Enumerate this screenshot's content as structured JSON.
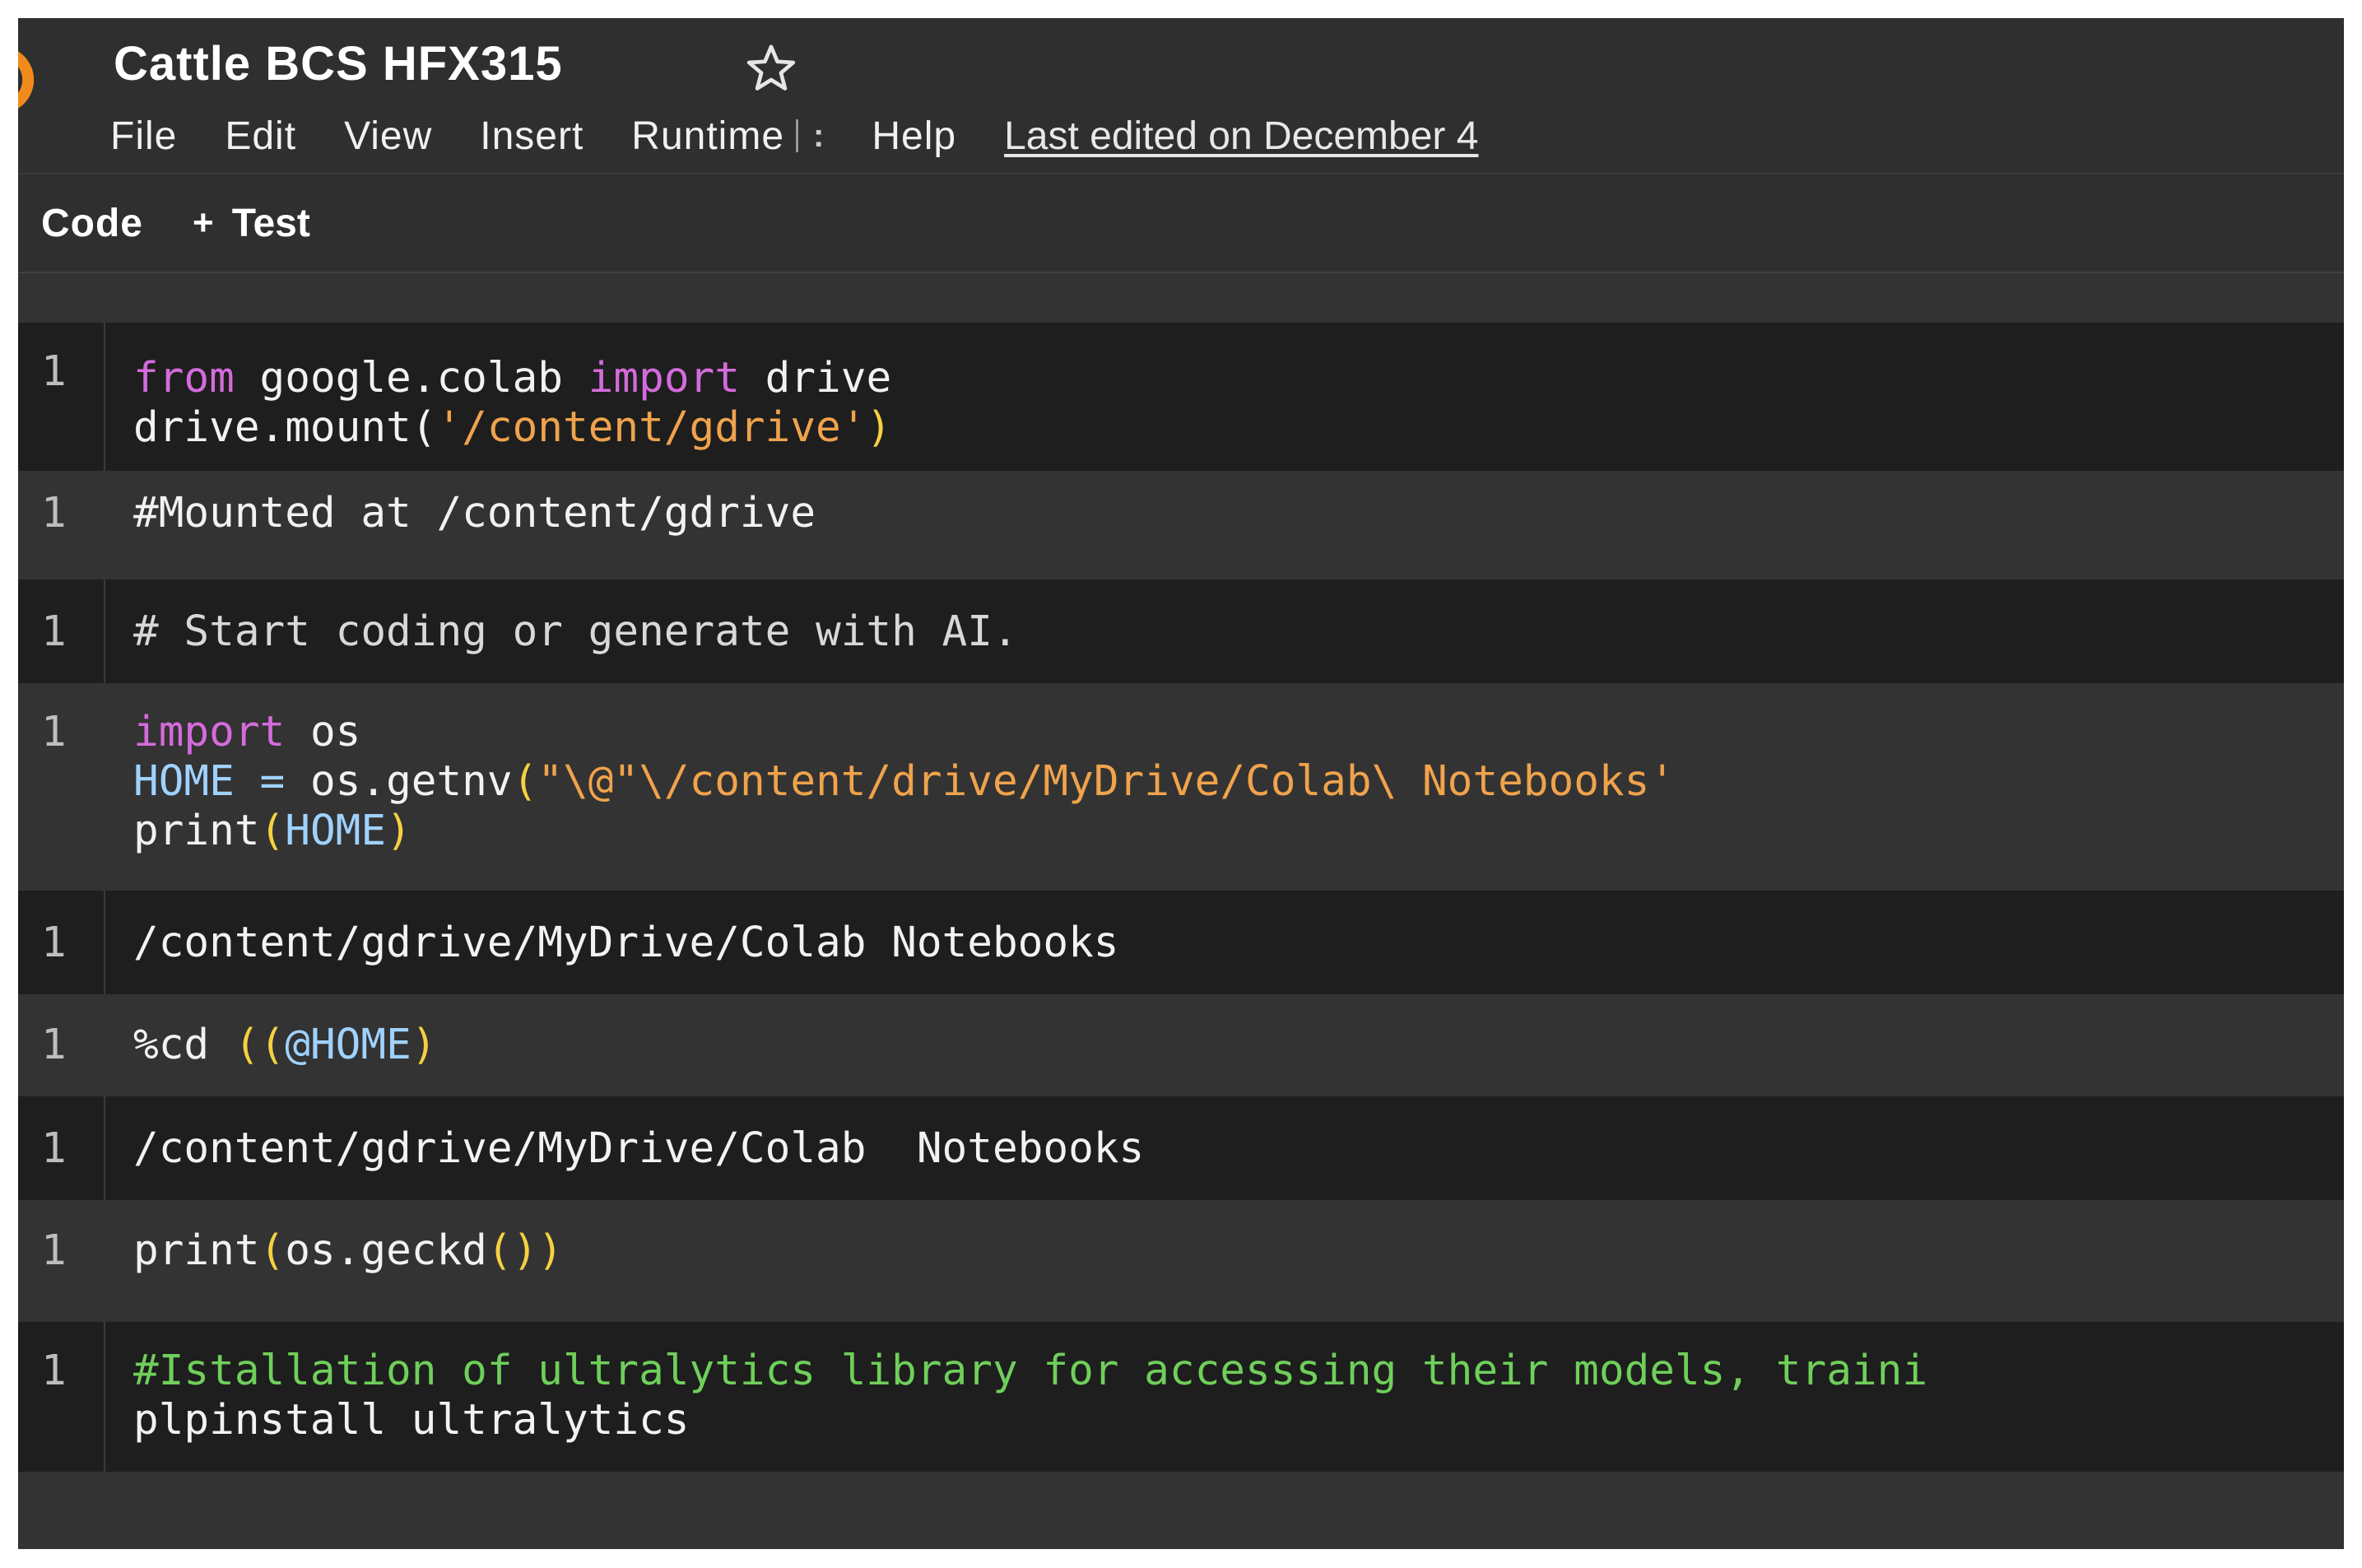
{
  "header": {
    "title": "Cattle BCS HFX315",
    "menu": [
      "File",
      "Edit",
      "View",
      "Insert",
      "Runtime"
    ],
    "help": "Help",
    "last_edited": "Last edited on December 4"
  },
  "toolbar": {
    "code_label": "Code",
    "plus": "+",
    "text_label": "Test"
  },
  "cells": [
    {
      "type": "code",
      "line_no": "1",
      "lines": [
        [
          "from",
          " google.colab ",
          "import",
          " drive"
        ],
        [
          "drive.mount(",
          "'/content/gdrive'",
          ")"
        ]
      ]
    },
    {
      "type": "output",
      "line_no": "1",
      "text": "#Mounted at /content/gdrive"
    },
    {
      "type": "code",
      "line_no": "1",
      "text": "# Start coding or generate with AI."
    },
    {
      "type": "code",
      "line_no": "1",
      "lines": [
        [
          "import",
          " os"
        ],
        [
          "HOME",
          " = ",
          "os.getnv",
          "(",
          "\"\\@\"\\/content/drive/MyDrive/Colab\\ Notebooks'"
        ],
        [
          "print",
          "(",
          "HOME",
          ")"
        ]
      ]
    },
    {
      "type": "output",
      "line_no": "1",
      "text": "/content/gdrive/MyDrive/Colab Notebooks"
    },
    {
      "type": "code",
      "line_no": "1",
      "parts": [
        "%cd ",
        "(",
        "(",
        "@HOME",
        ")"
      ]
    },
    {
      "type": "output",
      "line_no": "1",
      "text": "/content/gdrive/MyDrive/Colab  Notebooks"
    },
    {
      "type": "code",
      "line_no": "1",
      "parts": [
        "print",
        "(",
        "os.geckd",
        "()",
        ")"
      ]
    },
    {
      "type": "code",
      "line_no": "1",
      "lines": [
        "#Istallation of ultralytics library for accesssing their models, traini",
        "plpinstall ultralytics"
      ]
    }
  ],
  "colors": {
    "keyword": "#d56bdc",
    "string": "#f0a34c",
    "variable": "#9fd2ff",
    "paren": "#f5d142",
    "green_comment": "#6fcf5a",
    "logo_orange": "#f08a1c"
  },
  "icons": [
    "colab-logo-icon",
    "star-icon",
    "plus-icon"
  ]
}
